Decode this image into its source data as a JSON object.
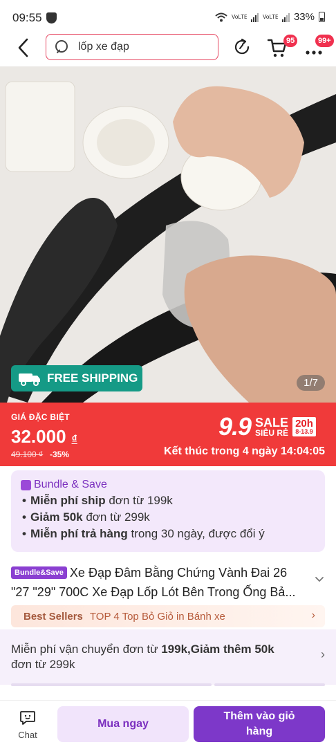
{
  "status_bar": {
    "time": "09:55",
    "sim1": "VoLTE1",
    "sim2": "VoLTE2",
    "battery": "33%"
  },
  "header": {
    "search_query": "lốp xe đạp",
    "cart_badge": "95",
    "more_badge": "99+"
  },
  "gallery": {
    "free_shipping": "FREE SHIPPING",
    "page_indicator": "1/7",
    "current_page": 1,
    "total_pages": 7
  },
  "price": {
    "label": "GIÁ ĐẶC BIỆT",
    "current": "32.000",
    "currency": "₫",
    "original": "49.100 ₫",
    "discount": "-35%",
    "sale_event": "9.9",
    "sale_word": "SALE",
    "sale_sub": "SIÊU RẺ",
    "sale_hours": "20h",
    "sale_dates": "8-13.9",
    "countdown": "Kết thúc trong 4 ngày 14:04:05"
  },
  "bundle": {
    "title": "Bundle & Save",
    "items": [
      {
        "bold": "Miễn phí ship",
        "rest": " đơn từ  199k"
      },
      {
        "bold": "Giảm 50k",
        "rest": "  đơn từ 299k"
      },
      {
        "bold": "Miễn phí trả hàng",
        "rest": " trong 30 ngày, được đổi ý"
      }
    ]
  },
  "product": {
    "tag": "Bundle&Save",
    "title": "Xe Đạp Đâm Bằng Chứng Vành Đai 26 \"27 \"29\" 700C Xe Đạp Lốp Lót Bên Trong Ống Bả..."
  },
  "best_sellers": {
    "label": "Best Sellers",
    "text": "TOP 4 Top Bỏ Giỏ in Bánh xe"
  },
  "shipping": {
    "line1": "Miễn phí vận chuyển đơn từ  ",
    "line1_bold": "199k,Giảm thêm 50k",
    "line2": "đơn từ 299k"
  },
  "bottom_bar": {
    "chat": "Chat",
    "buy_now": "Mua ngay",
    "add_to_cart": "Thêm vào giỏ hàng"
  },
  "colors": {
    "accent_purple": "#7d38c9",
    "sale_red": "#f03a3a",
    "free_ship_teal": "#159a86",
    "search_border": "#e64560"
  }
}
